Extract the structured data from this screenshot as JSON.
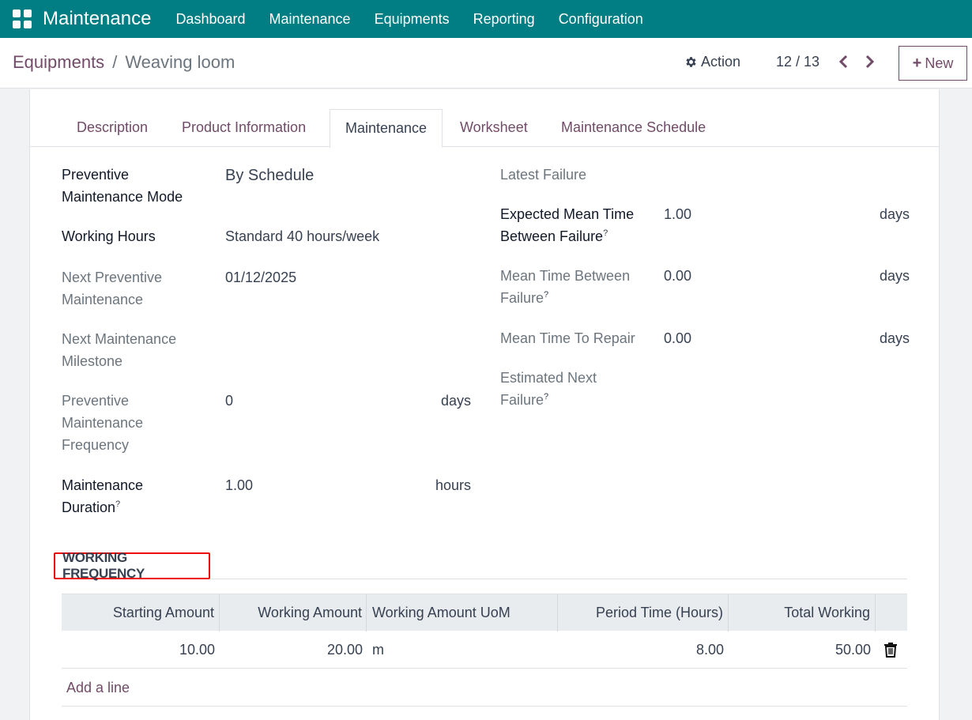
{
  "topbar": {
    "app_name": "Maintenance",
    "menu": [
      "Dashboard",
      "Maintenance",
      "Equipments",
      "Reporting",
      "Configuration"
    ],
    "bg_color": "#017e84"
  },
  "control": {
    "breadcrumb_parent": "Equipments",
    "breadcrumb_separator": "/",
    "breadcrumb_current": "Weaving loom",
    "action_label": "Action",
    "pager": "12 / 13",
    "new_label": "New",
    "accent_color": "#714b67"
  },
  "tabs": [
    "Description",
    "Product Information",
    "Maintenance",
    "Worksheet",
    "Maintenance Schedule"
  ],
  "active_tab": "Maintenance",
  "left_fields": {
    "mode_label_1": "Preventive",
    "mode_label_2": "Maintenance Mode",
    "mode_value": "By Schedule",
    "hours_label": "Working Hours",
    "hours_value": "Standard 40 hours/week",
    "next_prev_label_1": "Next Preventive",
    "next_prev_label_2": "Maintenance",
    "next_prev_value": "01/12/2025",
    "milestone_label_1": "Next Maintenance",
    "milestone_label_2": "Milestone",
    "freq_label_1": "Preventive",
    "freq_label_2": "Maintenance",
    "freq_label_3": "Frequency",
    "freq_value": "0",
    "freq_unit": "days",
    "duration_label_1": "Maintenance",
    "duration_label_2": "Duration",
    "duration_value": "1.00",
    "duration_unit": "hours"
  },
  "right_fields": {
    "latest_failure_label": "Latest Failure",
    "expected_mtbf_label_1": "Expected Mean Time",
    "expected_mtbf_label_2": "Between Failure",
    "expected_mtbf_value": "1.00",
    "expected_mtbf_unit": "days",
    "mtbf_label_1": "Mean Time Between",
    "mtbf_label_2": "Failure",
    "mtbf_value": "0.00",
    "mtbf_unit": "days",
    "mttr_label": "Mean Time To Repair",
    "mttr_value": "0.00",
    "mttr_unit": "days",
    "est_next_label_1": "Estimated Next",
    "est_next_label_2": "Failure"
  },
  "help_marker": "?",
  "working_frequency": {
    "title": "WORKING FREQUENCY",
    "columns": [
      "Starting Amount",
      "Working Amount",
      "Working Amount UoM",
      "Period Time (Hours)",
      "Total Working"
    ],
    "rows": [
      {
        "starting_amount": "10.00",
        "working_amount": "20.00",
        "uom": "m",
        "period_time": "8.00",
        "total_working": "50.00"
      }
    ],
    "add_line": "Add a line"
  }
}
